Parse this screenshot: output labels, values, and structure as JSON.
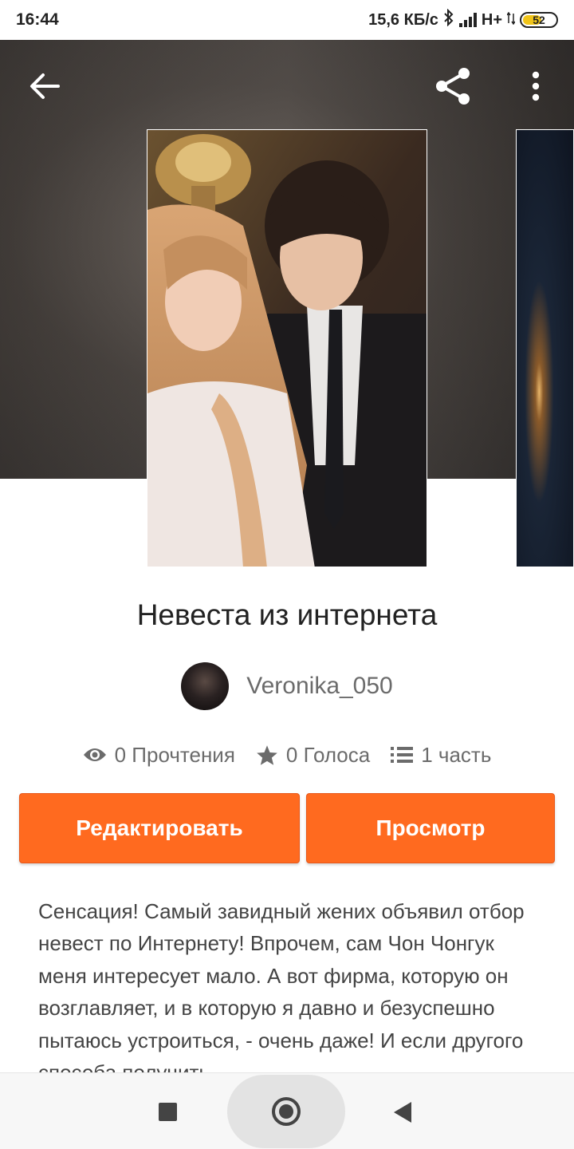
{
  "status_bar": {
    "time": "16:44",
    "network_speed": "15,6 КБ/с",
    "network_type": "H+",
    "battery": "52"
  },
  "toolbar": {
    "back_icon": "arrow-left-icon",
    "share_icon": "share-icon",
    "more_icon": "more-vertical-icon"
  },
  "story": {
    "title": "Невеста из интернета",
    "author": "Veronika_050",
    "stats": {
      "reads": "0 Прочтения",
      "votes": "0 Голоса",
      "parts": "1 часть"
    },
    "description": "Сенсация! Самый завидный жених объявил отбор невест по Интернету! Впрочем, сам Чон Чонгук меня интересует мало. А вот фирма, которую он возглавляет, и в которую я давно и безуспешно пытаюсь устроиться, - очень даже! И если другого способа получить"
  },
  "actions": {
    "edit_label": "Редактировать",
    "view_label": "Просмотр"
  },
  "colors": {
    "accent": "#ff6a1f",
    "muted_text": "#6b6b6b"
  }
}
